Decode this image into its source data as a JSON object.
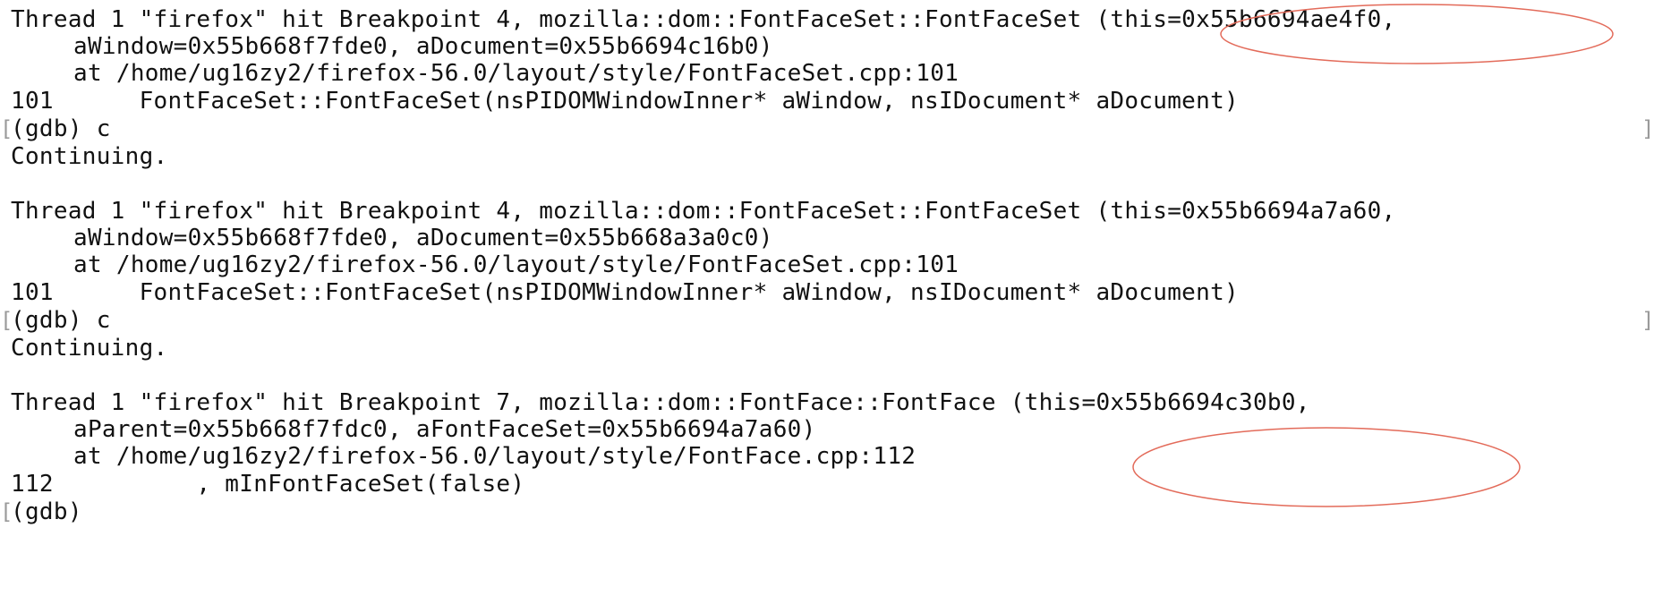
{
  "terminal": {
    "lines": [
      "Thread 1 \"firefox\" hit Breakpoint 4, mozilla::dom::FontFaceSet::FontFaceSet (this=0x55b6694ae4f0,",
      "aWindow=0x55b668f7fde0, aDocument=0x55b6694c16b0)",
      "at /home/ug16zy2/firefox-56.0/layout/style/FontFaceSet.cpp:101",
      "101      FontFaceSet::FontFaceSet(nsPIDOMWindowInner* aWindow, nsIDocument* aDocument)",
      "(gdb) c",
      "Continuing.",
      "",
      "Thread 1 \"firefox\" hit Breakpoint 4, mozilla::dom::FontFaceSet::FontFaceSet (this=0x55b6694a7a60,",
      "aWindow=0x55b668f7fde0, aDocument=0x55b668a3a0c0)",
      "at /home/ug16zy2/firefox-56.0/layout/style/FontFaceSet.cpp:101",
      "101      FontFaceSet::FontFaceSet(nsPIDOMWindowInner* aWindow, nsIDocument* aDocument)",
      "(gdb) c",
      "Continuing.",
      "",
      "Thread 1 \"firefox\" hit Breakpoint 7, mozilla::dom::FontFace::FontFace (this=0x55b6694c30b0,",
      "aParent=0x55b668f7fdc0, aFontFaceSet=0x55b6694a7a60)",
      "at /home/ug16zy2/firefox-56.0/layout/style/FontFace.cpp:112",
      "112          , mInFontFaceSet(false)",
      "(gdb)"
    ],
    "prompt_bracket_left": "[",
    "prompt_bracket_right": "]"
  },
  "colors": {
    "text": "#111111",
    "annotation": "#e36b5a",
    "bracket": "#9a9a9a"
  }
}
